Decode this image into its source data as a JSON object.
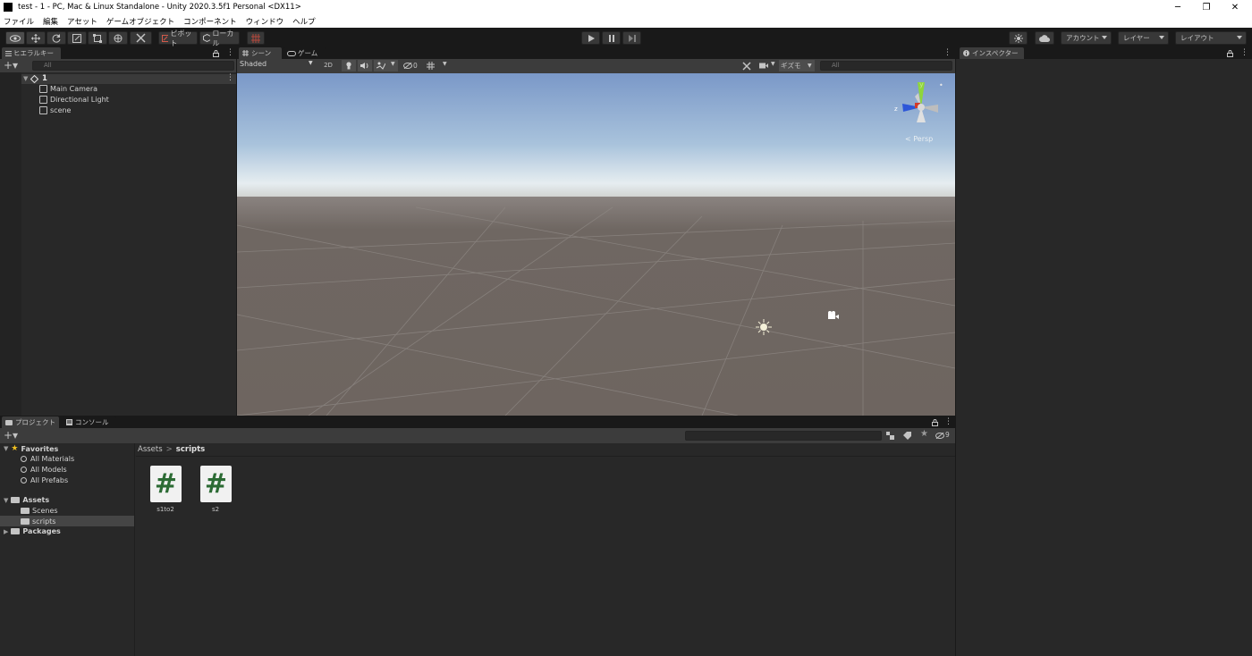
{
  "window": {
    "title": "test - 1 - PC, Mac & Linux Standalone - Unity 2020.3.5f1 Personal <DX11>",
    "controls": [
      "─",
      "❐",
      "✕"
    ]
  },
  "menu": [
    "ファイル",
    "編集",
    "アセット",
    "ゲームオブジェクト",
    "コンポーネント",
    "ウィンドウ",
    "ヘルプ"
  ],
  "toolbar": {
    "pivot": "ピボット",
    "local": "ローカル",
    "account": "アカウント",
    "layers": "レイヤー",
    "layout": "レイアウト"
  },
  "hierarchy": {
    "tab": "ヒエラルキー",
    "search_placeholder": "All",
    "scene": "1",
    "items": [
      "Main Camera",
      "Directional Light",
      "scene"
    ]
  },
  "scene_view": {
    "tab_scene": "シーン",
    "tab_game": "ゲーム",
    "shading": "Shaded",
    "mode_2d": "2D",
    "hidden_count": "0",
    "gizmos": "ギズモ",
    "search_placeholder": "All",
    "persp_label": "< Persp",
    "axis_y": "y",
    "axis_z": "z"
  },
  "inspector": {
    "tab": "インスペクター"
  },
  "project": {
    "tab_project": "プロジェクト",
    "tab_console": "コンソール",
    "hidden_count": "9",
    "favorites_label": "Favorites",
    "favorites": [
      "All Materials",
      "All Models",
      "All Prefabs"
    ],
    "assets_label": "Assets",
    "assets_children": [
      "Scenes",
      "scripts"
    ],
    "packages_label": "Packages",
    "breadcrumb_root": "Assets",
    "breadcrumb_sep": ">",
    "breadcrumb_current": "scripts",
    "files": [
      {
        "name": "s1to2",
        "icon": "#"
      },
      {
        "name": "s2",
        "icon": "#"
      }
    ]
  }
}
